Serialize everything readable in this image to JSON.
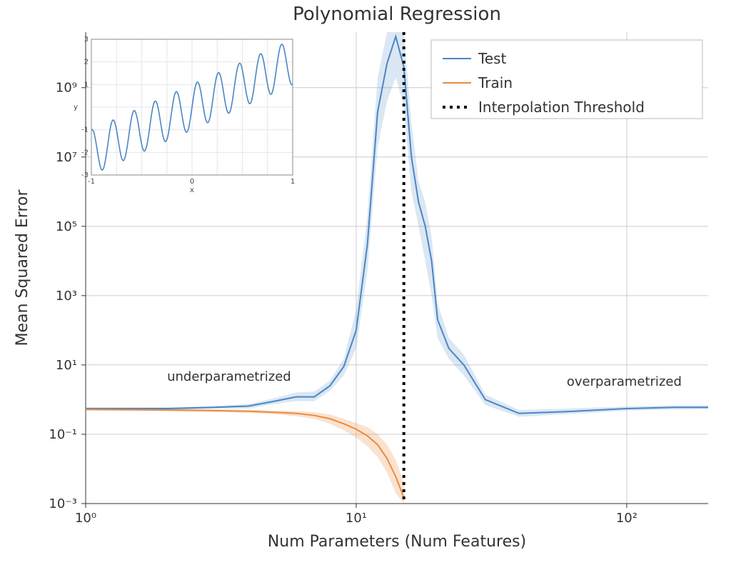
{
  "chart_data": {
    "type": "line",
    "title": "Polynomial Regression",
    "xlabel": "Num  Parameters (Num Features)",
    "ylabel": "Mean Squared Error",
    "x_scale": "log",
    "y_scale": "log",
    "xlim": [
      1,
      200
    ],
    "ylim": [
      0.001,
      40000000000.0
    ],
    "x_ticks": [
      1,
      10,
      100
    ],
    "x_tick_labels": [
      "10⁰",
      "10¹",
      "10²"
    ],
    "y_ticks": [
      0.001,
      0.1,
      10.0,
      1000.0,
      100000.0,
      10000000.0,
      1000000000.0
    ],
    "y_tick_labels": [
      "10⁻³",
      "10⁻¹",
      "10¹",
      "10³",
      "10⁵",
      "10⁷",
      "10⁹"
    ],
    "interpolation_threshold": 15,
    "annotations": {
      "under": "underparametrized",
      "over": "overparametrized"
    },
    "legend": {
      "test": "Test",
      "train": "Train",
      "threshold": "Interpolation Threshold"
    },
    "series": [
      {
        "name": "Test",
        "x": [
          1,
          2,
          3,
          4,
          5,
          6,
          7,
          8,
          9,
          10,
          11,
          12,
          13,
          14,
          15,
          16,
          17,
          18,
          19,
          20,
          22,
          25,
          30,
          40,
          60,
          100,
          150,
          200
        ],
        "y": [
          0.55,
          0.55,
          0.6,
          0.65,
          0.9,
          1.2,
          1.2,
          2.5,
          9,
          100,
          30000.0,
          200000000.0,
          5000000000.0,
          30000000000.0,
          4000000000.0,
          10000000.0,
          500000.0,
          100000.0,
          10000.0,
          200,
          30,
          10,
          1,
          0.4,
          0.45,
          0.55,
          0.6,
          0.6
        ],
        "lo": [
          0.5,
          0.5,
          0.55,
          0.55,
          0.75,
          0.9,
          0.9,
          1.8,
          5,
          30,
          5000.0,
          20000000.0,
          400000000.0,
          2000000000.0,
          300000000.0,
          1000000.0,
          100000.0,
          10000.0,
          1000.0,
          60,
          15,
          5,
          0.7,
          0.32,
          0.38,
          0.48,
          0.52,
          0.53
        ],
        "hi": [
          0.6,
          0.6,
          0.65,
          0.75,
          1.1,
          1.6,
          1.7,
          3.5,
          15,
          400,
          200000.0,
          2000000000.0,
          40000000000.0,
          40000000000.0,
          40000000000.0,
          100000000.0,
          2000000.0,
          500000.0,
          50000.0,
          600,
          60,
          20,
          1.4,
          0.5,
          0.55,
          0.63,
          0.68,
          0.68
        ]
      },
      {
        "name": "Train",
        "x": [
          1,
          2,
          3,
          4,
          5,
          6,
          7,
          8,
          9,
          10,
          11,
          12,
          13,
          14,
          15
        ],
        "y": [
          0.52,
          0.5,
          0.48,
          0.46,
          0.43,
          0.4,
          0.35,
          0.28,
          0.2,
          0.14,
          0.09,
          0.05,
          0.02,
          0.006,
          0.0015
        ],
        "lo": [
          0.48,
          0.46,
          0.44,
          0.41,
          0.38,
          0.33,
          0.28,
          0.2,
          0.13,
          0.08,
          0.045,
          0.022,
          0.008,
          0.002,
          0.001
        ],
        "hi": [
          0.56,
          0.54,
          0.52,
          0.51,
          0.48,
          0.47,
          0.43,
          0.37,
          0.28,
          0.21,
          0.16,
          0.1,
          0.05,
          0.018,
          0.004
        ]
      }
    ],
    "inset": {
      "type": "line",
      "xlabel": "x",
      "ylabel": "y",
      "xlim": [
        -1,
        1
      ],
      "ylim": [
        -3,
        3
      ],
      "x_ticks": [
        -1,
        0,
        1
      ],
      "y_ticks": [
        -3,
        -2,
        -1,
        1,
        2,
        3
      ],
      "note": "y ≈ 2x + sin(30x) sampled over [-1,1]"
    }
  }
}
